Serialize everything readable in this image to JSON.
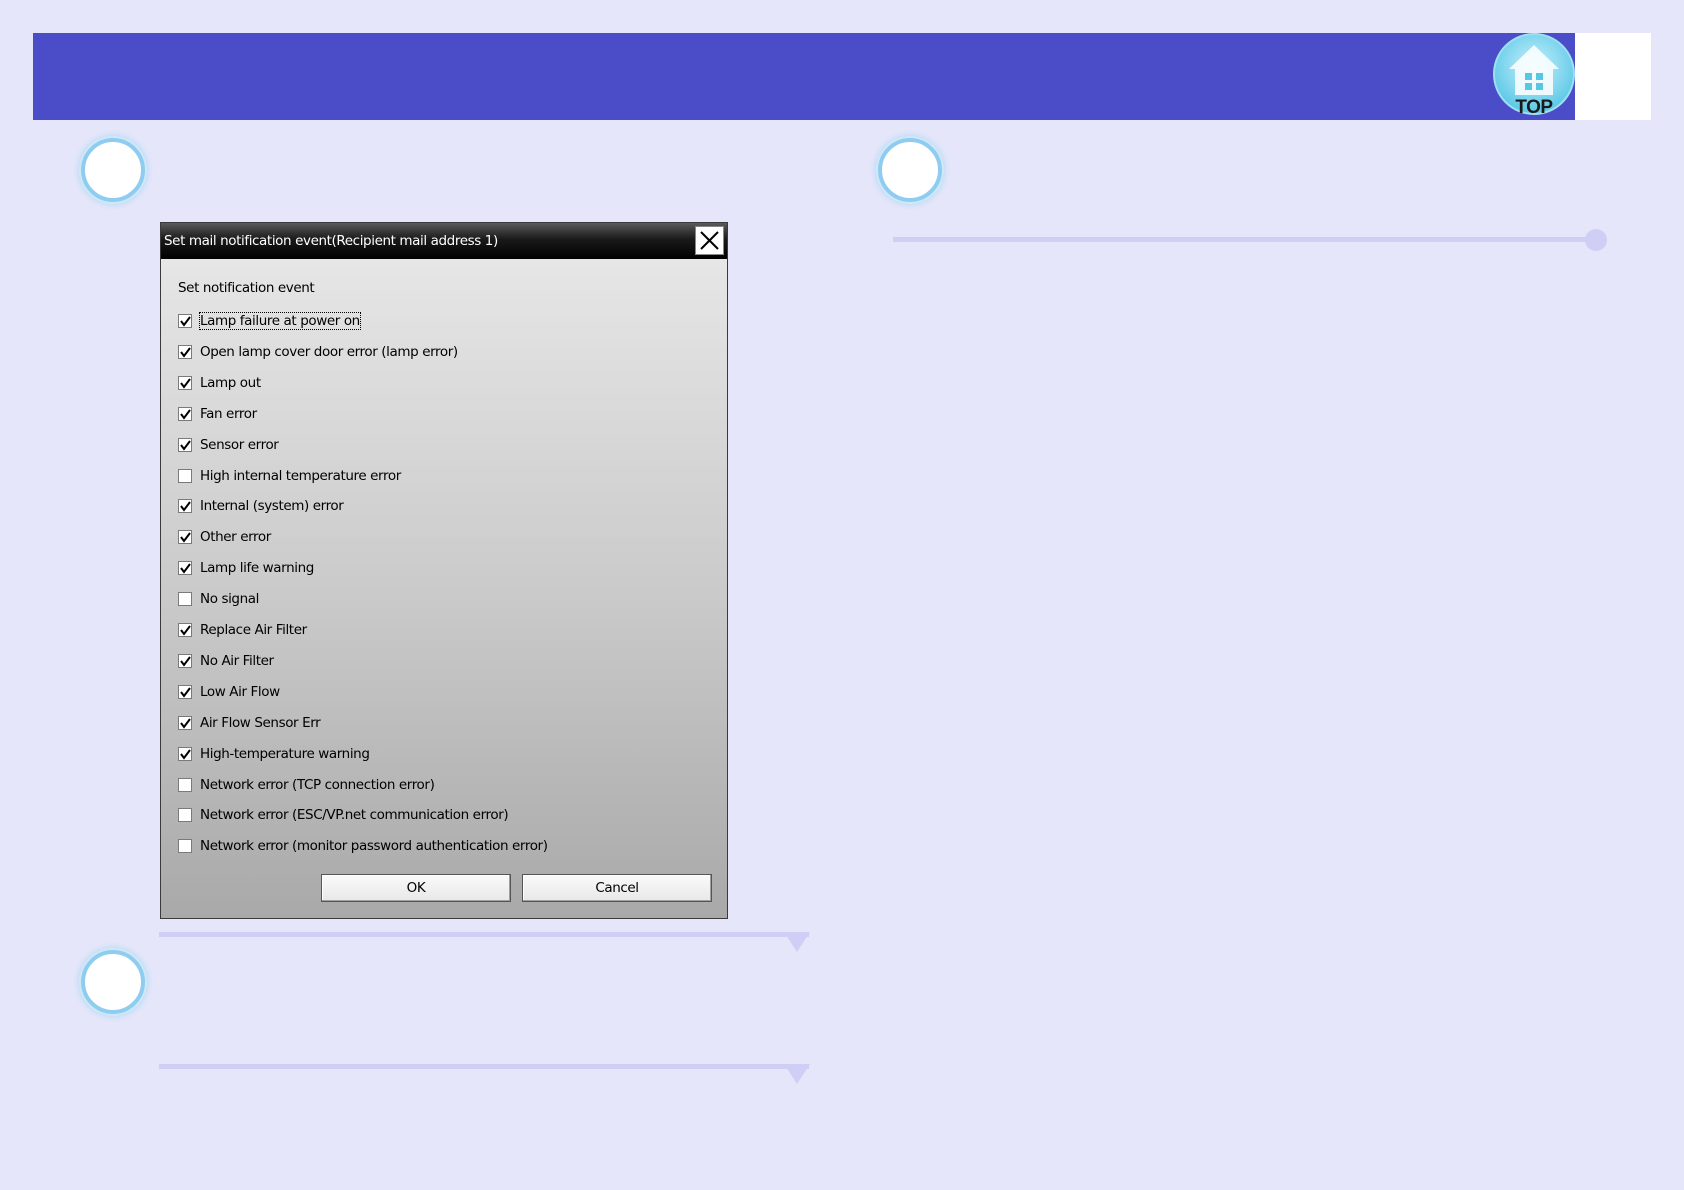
{
  "header": {
    "top_button_label": "TOP"
  },
  "dialog": {
    "title": "Set mail notification event(Recipient mail address 1)",
    "section_label": "Set notification event",
    "events": [
      {
        "label": "Lamp failure at power on",
        "checked": true
      },
      {
        "label": "Open lamp cover door error (lamp error)",
        "checked": true
      },
      {
        "label": "Lamp out",
        "checked": true
      },
      {
        "label": "Fan error",
        "checked": true
      },
      {
        "label": "Sensor error",
        "checked": true
      },
      {
        "label": "High internal temperature error",
        "checked": false
      },
      {
        "label": "Internal (system) error",
        "checked": true
      },
      {
        "label": "Other error",
        "checked": true
      },
      {
        "label": "Lamp life warning",
        "checked": true
      },
      {
        "label": "No signal",
        "checked": false
      },
      {
        "label": "Replace Air Filter",
        "checked": true
      },
      {
        "label": "No Air Filter",
        "checked": true
      },
      {
        "label": "Low Air Flow",
        "checked": true
      },
      {
        "label": "Air Flow Sensor Err",
        "checked": true
      },
      {
        "label": "High-temperature warning",
        "checked": true
      },
      {
        "label": "Network error (TCP connection error)",
        "checked": false
      },
      {
        "label": "Network error (ESC/VP.net communication error)",
        "checked": false
      },
      {
        "label": "Network error (monitor password authentication error)",
        "checked": false
      }
    ],
    "ok_label": "OK",
    "cancel_label": "Cancel"
  }
}
